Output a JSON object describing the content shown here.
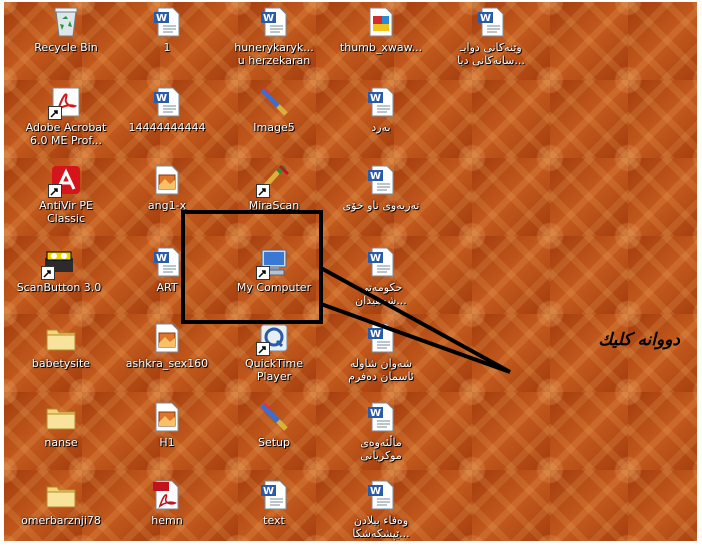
{
  "desktop": {
    "icons": {
      "recycle_bin": "Recycle Bin",
      "file_1": "1",
      "hunery": "hunerykaryk...\nu herzekaran",
      "thumb": "thumb_xwaw...",
      "top_rtl": "وێنەکانی دوایـ\n...سانەکانی دیا",
      "acrobat": "Adobe Acrobat\n6.0 ME Prof...",
      "num_doc": "14444444444",
      "image5": "Image5",
      "bard": "بەرد",
      "antivir": "AntiVir PE\nClassic",
      "ang1": "ang1-x",
      "mirascan": "MiraScan",
      "tazia": "تەزیەوی ناو خۆی",
      "scanbutton": "ScanButton 3.0",
      "art": "ART",
      "my_computer": "My Computer",
      "hkumati": "حکومەتی\n...شەهیدان",
      "babetysite": "babetysite",
      "ashkra": "ashkra_sex160",
      "quicktime": "QuickTime\nPlayer",
      "shwan": "شەوان شاولە\nئاسمان دەفرم",
      "nanse": "nanse",
      "h1": "H1",
      "setup": "Setup",
      "malat": "ماڵئەوەی\nموکریانی",
      "omerbarznji": "omerbarznji78",
      "hemn": "hemn",
      "text": "text",
      "wafa": "وەفاء بیلادن\n...ێپشکەشکا"
    }
  },
  "annotation": {
    "text": "دووانە کلیك"
  },
  "colors": {
    "desktop": "#b04a14",
    "highlight_box": "#000000"
  },
  "icon_names": [
    "recycle-bin-icon",
    "word-document-icon",
    "image-file-icon",
    "pdf-file-icon",
    "folder-icon",
    "my-computer-icon",
    "quicktime-icon",
    "setup-icon",
    "acrobat-icon",
    "antivir-icon",
    "scanner-icon"
  ]
}
